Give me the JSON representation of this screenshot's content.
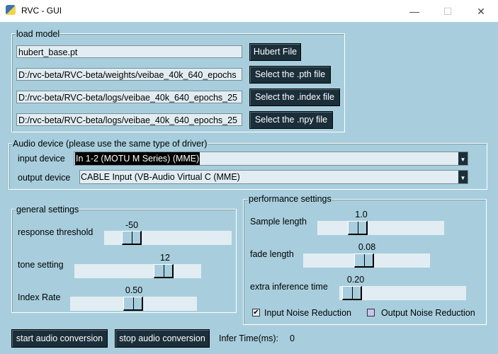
{
  "window": {
    "title": "RVC - GUI"
  },
  "load_model": {
    "label": "load model",
    "rows": [
      {
        "value": "hubert_base.pt",
        "button": "Hubert File"
      },
      {
        "value": "D:/rvc-beta/RVC-beta/weights/veibae_40k_640_epochs",
        "button": "Select the .pth file"
      },
      {
        "value": "D:/rvc-beta/RVC-beta/logs/veibae_40k_640_epochs_25",
        "button": "Select the .index file"
      },
      {
        "value": "D:/rvc-beta/RVC-beta/logs/veibae_40k_640_epochs_25",
        "button": "Select the .npy file"
      }
    ]
  },
  "audio": {
    "label": "Audio device (please use the same type of driver)",
    "input_label": "input device",
    "input_value": "In 1-2 (MOTU M Series) (MME)",
    "output_label": "output device",
    "output_value": "CABLE Input (VB-Audio Virtual C (MME)"
  },
  "general": {
    "label": "general settings",
    "sliders": [
      {
        "label": "response threshold",
        "value": "-50"
      },
      {
        "label": "tone setting",
        "value": "12"
      },
      {
        "label": "Index Rate",
        "value": "0.50"
      }
    ]
  },
  "performance": {
    "label": "performance settings",
    "sliders": [
      {
        "label": "Sample length",
        "value": "1.0"
      },
      {
        "label": "fade length",
        "value": "0.08"
      },
      {
        "label": "extra inference time",
        "value": "0.20"
      }
    ],
    "input_noise": {
      "label": "Input Noise Reduction",
      "checked": true
    },
    "output_noise": {
      "label": "Output Noise Reduction",
      "checked": false
    }
  },
  "bottom": {
    "start": "start audio conversion",
    "stop": "stop audio conversion",
    "infer_label": "Infer Time(ms):",
    "infer_value": "0"
  }
}
